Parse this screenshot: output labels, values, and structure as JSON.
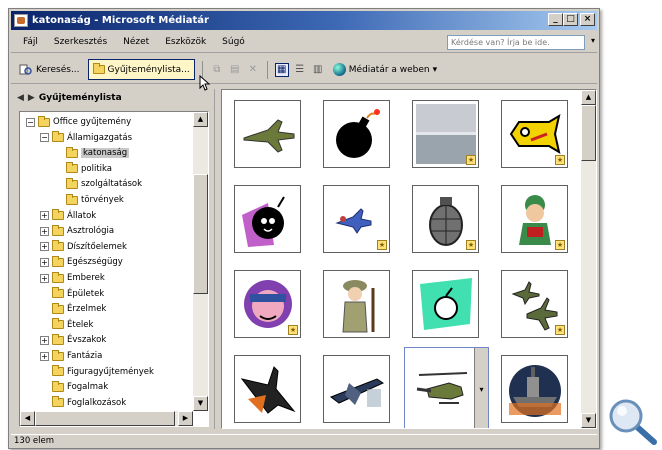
{
  "window": {
    "title": "katonaság - Microsoft Médiatár"
  },
  "title_buttons": {
    "minimize": "_",
    "maximize": "□",
    "close": "×"
  },
  "menubar": {
    "items": [
      "Fájl",
      "Szerkesztés",
      "Nézet",
      "Eszközök",
      "Súgó"
    ],
    "help_placeholder": "Kérdése van? Írja be ide.",
    "help_arrow": "▾"
  },
  "toolbar": {
    "search_label": "Keresés...",
    "collections_label": "Gyűjteménylista...",
    "web_label": "Médiatár a weben",
    "web_dropdown": "▾"
  },
  "left_pane": {
    "title": "Gyűjteménylista",
    "tree": [
      {
        "label": "Office gyűjtemény",
        "level": 0,
        "expander": "−"
      },
      {
        "label": "Államigazgatás",
        "level": 1,
        "expander": "−"
      },
      {
        "label": "katonaság",
        "level": 2,
        "expander": "",
        "selected": true
      },
      {
        "label": "politika",
        "level": 2,
        "expander": ""
      },
      {
        "label": "szolgáltatások",
        "level": 2,
        "expander": ""
      },
      {
        "label": "törvények",
        "level": 2,
        "expander": ""
      },
      {
        "label": "Állatok",
        "level": 1,
        "expander": "+"
      },
      {
        "label": "Asztrológia",
        "level": 1,
        "expander": "+"
      },
      {
        "label": "Díszítőelemek",
        "level": 1,
        "expander": "+"
      },
      {
        "label": "Egészségügy",
        "level": 1,
        "expander": "+"
      },
      {
        "label": "Emberek",
        "level": 1,
        "expander": "+"
      },
      {
        "label": "Épületek",
        "level": 1,
        "expander": ""
      },
      {
        "label": "Érzelmek",
        "level": 1,
        "expander": ""
      },
      {
        "label": "Ételek",
        "level": 1,
        "expander": ""
      },
      {
        "label": "Évszakok",
        "level": 1,
        "expander": "+"
      },
      {
        "label": "Fantázia",
        "level": 1,
        "expander": "+"
      },
      {
        "label": "Figuragyűjtemények",
        "level": 1,
        "expander": ""
      },
      {
        "label": "Fogalmak",
        "level": 1,
        "expander": ""
      },
      {
        "label": "Foglalkozások",
        "level": 1,
        "expander": ""
      }
    ]
  },
  "clips": [
    {
      "name": "fighter-jet-clip",
      "badge": false
    },
    {
      "name": "bomb-clip",
      "badge": false
    },
    {
      "name": "gray-photo-clip",
      "badge": true
    },
    {
      "name": "yellow-fish-clip",
      "badge": true
    },
    {
      "name": "purple-bomb-clip",
      "badge": false
    },
    {
      "name": "small-plane-clip",
      "badge": true
    },
    {
      "name": "grenade-clip",
      "badge": true
    },
    {
      "name": "green-soldier-clip",
      "badge": true
    },
    {
      "name": "pilot-face-clip",
      "badge": true
    },
    {
      "name": "soldier-rifle-clip",
      "badge": false
    },
    {
      "name": "grenade-green-clip",
      "badge": false
    },
    {
      "name": "jet-formation-clip",
      "badge": true
    },
    {
      "name": "stealth-jet-clip",
      "badge": false
    },
    {
      "name": "b52-bomber-clip",
      "badge": false
    },
    {
      "name": "helicopter-clip",
      "badge": false,
      "selected": true
    },
    {
      "name": "warship-clip",
      "badge": false
    }
  ],
  "badge_glyph": "★",
  "clip_dropdown": "▾",
  "statusbar": {
    "text": "130 elem"
  },
  "colors": {
    "title_start": "#0a246a",
    "title_end": "#a6caf0",
    "face": "#d4d0c8",
    "highlight": "#fff6c8",
    "folder": "#f4d35e"
  }
}
